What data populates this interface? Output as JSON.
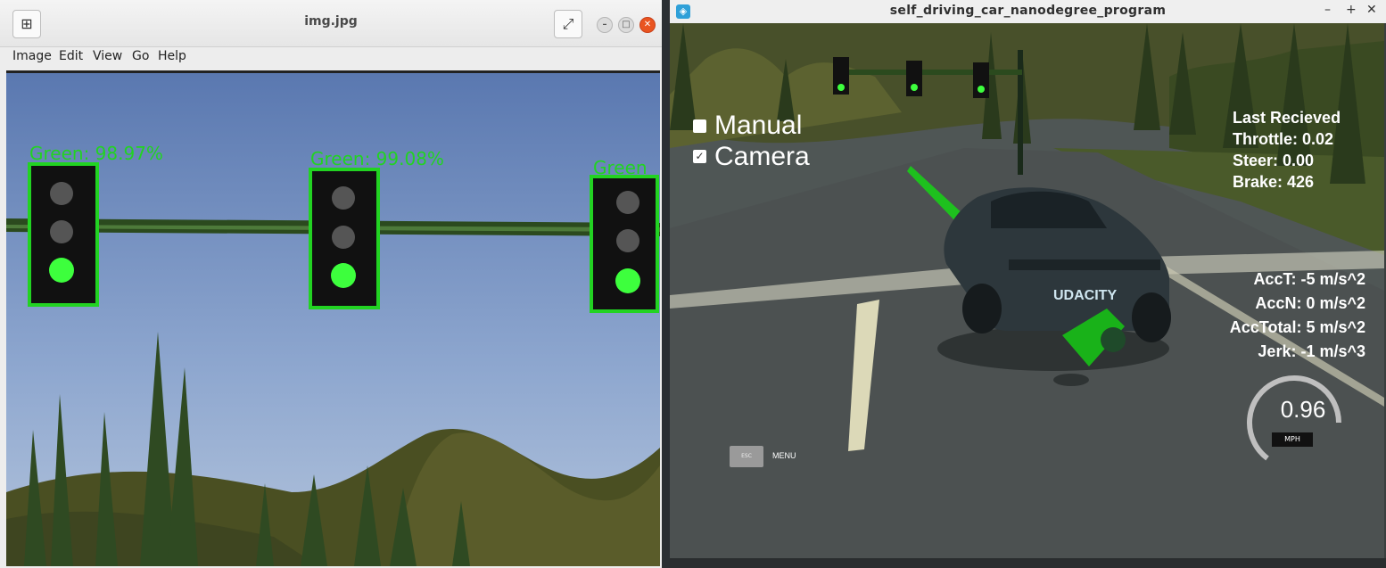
{
  "viewer": {
    "title": "img.jpg",
    "menu": [
      "Image",
      "Edit",
      "View",
      "Go",
      "Help"
    ],
    "detections": [
      {
        "label": "Green: 98.97%"
      },
      {
        "label": "Green: 99.08%"
      },
      {
        "label": "Green"
      }
    ],
    "detection_color": "#22d322"
  },
  "sim": {
    "title": "self_driving_car_nanodegree_program",
    "controls": {
      "minimize": "–",
      "maximize": "+",
      "close": "✕"
    },
    "manual_label": "Manual",
    "camera_label": "Camera",
    "manual_checked": false,
    "camera_checked": true,
    "last_received": {
      "heading": "Last Recieved",
      "throttle": "Throttle: 0.02",
      "steer": "Steer: 0.00",
      "brake": "Brake: 426"
    },
    "accel": {
      "acct": "AccT: -5 m/s^2",
      "accn": "AccN: 0 m/s^2",
      "acctotal": "AccTotal: 5 m/s^2",
      "jerk": "Jerk: -1 m/s^3"
    },
    "speed": {
      "value": "0.96",
      "unit": "MPH"
    },
    "esc_label": "ESC",
    "menu_label": "MENU",
    "car_brand": "UDACITY"
  }
}
